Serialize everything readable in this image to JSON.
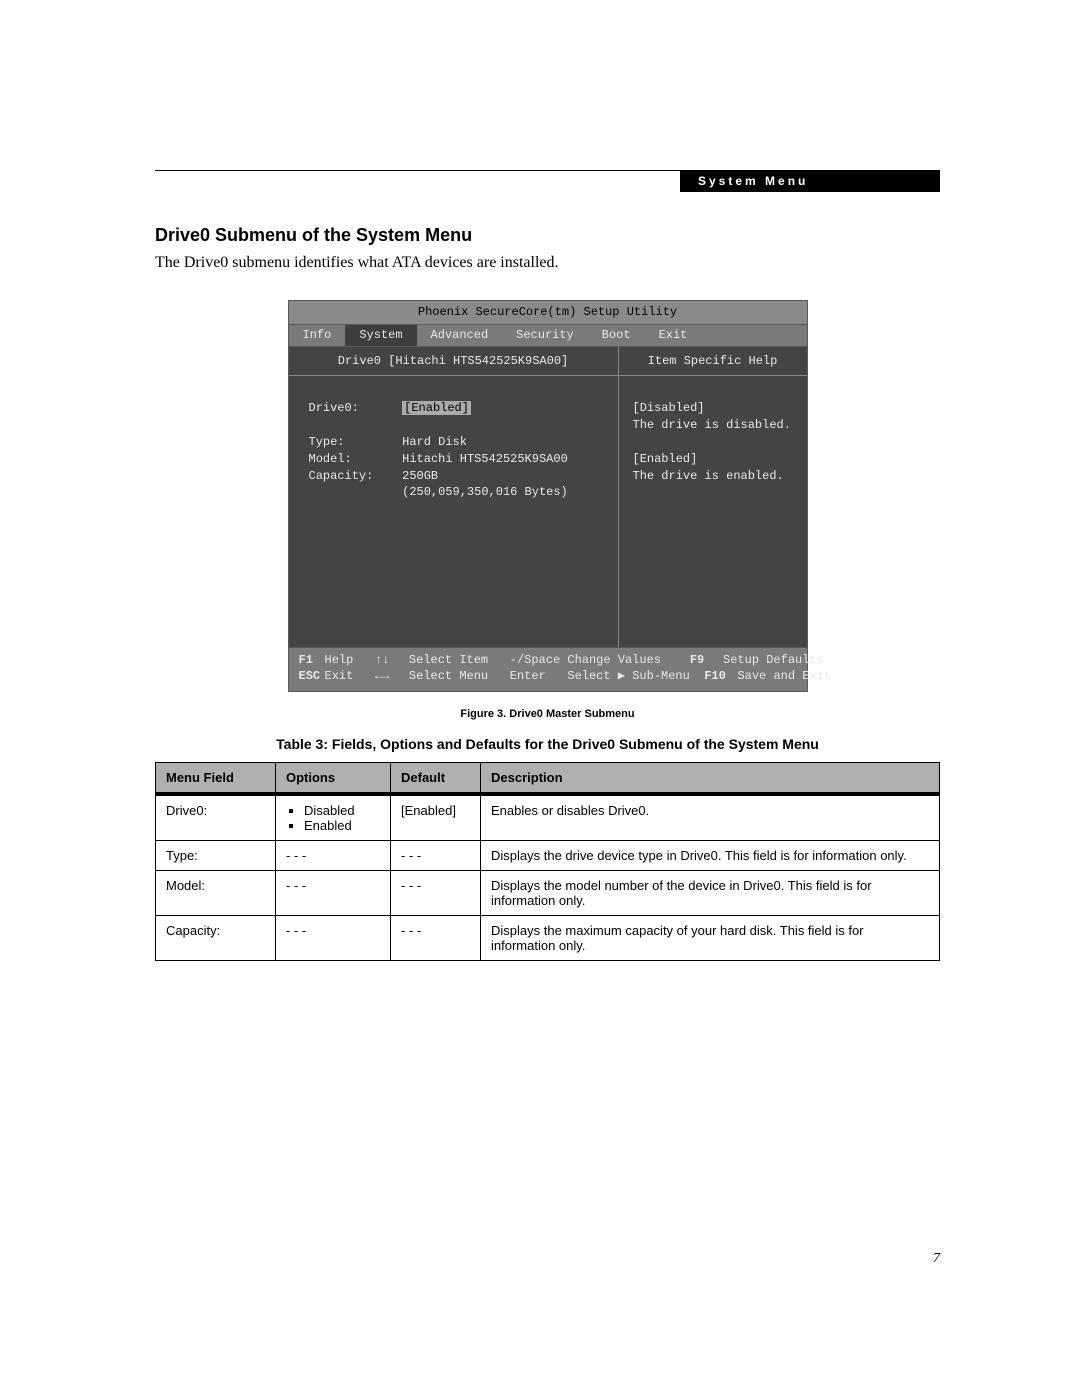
{
  "header": {
    "tab_label": "System Menu"
  },
  "section": {
    "title": "Drive0 Submenu of the System Menu",
    "intro": "The Drive0 submenu identifies what ATA devices are installed."
  },
  "bios": {
    "utility_title": "Phoenix SecureCore(tm) Setup Utility",
    "tabs": [
      "Info",
      "System",
      "Advanced",
      "Security",
      "Boot",
      "Exit"
    ],
    "active_tab": "System",
    "left_header": "Drive0 [Hitachi HTS542525K9SA00]",
    "right_header": "Item Specific Help",
    "fields": {
      "drive0_label": "Drive0:",
      "drive0_value": "[Enabled]",
      "type_label": "Type:",
      "type_value": "Hard Disk",
      "model_label": "Model:",
      "model_value": "Hitachi HTS542525K9SA00",
      "capacity_label": "Capacity:",
      "capacity_value": "250GB",
      "capacity_bytes": "(250,059,350,016 Bytes)"
    },
    "help": "[Disabled]\nThe drive is disabled.\n\n[Enabled]\nThe drive is enabled.",
    "footer": {
      "line1": {
        "k1": "F1",
        "a1": "Help",
        "n1": "↑↓",
        "a2": "Select Item",
        "k2": "-/Space",
        "a3": "Change Values",
        "k3": "F9",
        "a4": "Setup Defaults"
      },
      "line2": {
        "k1": "ESC",
        "a1": "Exit",
        "n1": "←→",
        "a2": "Select Menu",
        "k2": "Enter",
        "a3": "Select ▶ Sub-Menu",
        "k3": "F10",
        "a4": "Save and Exit"
      }
    }
  },
  "figure_caption": "Figure 3.  Drive0 Master Submenu",
  "table_title": "Table 3: Fields, Options and Defaults for the Drive0 Submenu of the System Menu",
  "table": {
    "headers": {
      "c1": "Menu Field",
      "c2": "Options",
      "c3": "Default",
      "c4": "Description"
    },
    "rows": [
      {
        "field": "Drive0:",
        "options": [
          "Disabled",
          "Enabled"
        ],
        "def": "[Enabled]",
        "desc": "Enables or disables Drive0."
      },
      {
        "field": "Type:",
        "options_text": "- - -",
        "def": "- - -",
        "desc": "Displays the drive device type in Drive0. This field is for information only."
      },
      {
        "field": "Model:",
        "options_text": "- - -",
        "def": "- - -",
        "desc": "Displays the model number of the device in Drive0. This field is for information only."
      },
      {
        "field": "Capacity:",
        "options_text": "- - -",
        "def": "- - -",
        "desc": "Displays the maximum capacity of your hard disk. This field is for information only."
      }
    ]
  },
  "page_number": "7"
}
